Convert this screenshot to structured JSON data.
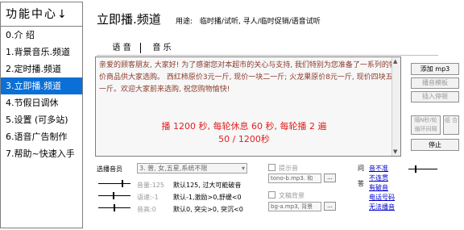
{
  "sidebar": {
    "title": "功能中心↓",
    "items": [
      {
        "label": "0.介 绍"
      },
      {
        "label": "1.背景音乐.频道"
      },
      {
        "label": "2.定时播.频道"
      },
      {
        "label": "3.立即播.频道"
      },
      {
        "label": "4.节假日调休"
      },
      {
        "label": "5.设置 (可多站)"
      },
      {
        "label": "6.语音广告制作"
      },
      {
        "label": "7.帮助~快速入手"
      }
    ],
    "active_index": 3
  },
  "header": {
    "title": "立即播.频道",
    "usage_label": "用途:",
    "usage_text": "临时播/试听, 寻人/临时促销/语音试听"
  },
  "tabs": [
    {
      "label": "语 音",
      "active": true
    },
    {
      "label": "音 乐",
      "active": false
    }
  ],
  "message": "亲爱的顾客朋友, 大家好! 为了感谢您对本超市的关心与支持, 我们特别为您准备了一系列的特价商品供大家选购。 西红柿原价3元一斤, 现价一块二一斤; 火龙果原价8元一斤, 现价四块五一斤。欢迎大家前来选购, 祝您购物愉快!",
  "playback": {
    "line1": "播 1200 秒, 每轮休息 60 秒, 每轮播 2 遍",
    "line2": "50 / 1200秒"
  },
  "buttons": {
    "add": "添加 mp3",
    "sample": "播音模板",
    "insert": "插入停顿",
    "interval": "隔N秒/轮 循环间隔",
    "combo": "组 合",
    "stop": "停止"
  },
  "voice": {
    "speaker_label": "选播音员",
    "speaker_value": "3. 普, 女,五星,系统不限",
    "volume_label": "音量:125",
    "volume_desc": "默认125, 过大可能破音",
    "rate_label": "语速:-1",
    "rate_desc": "默认-1,激励>0,舒缓<0",
    "pitch_label": "音高:0",
    "pitch_desc": "默认0, 突尖>0, 突沉<0"
  },
  "options": {
    "prompt_tone_label": "提示音",
    "prompt_tone_file": "tono-b.mp3. 和",
    "text_bg_label": "文稿背景",
    "text_bg_file": "bg-a.mp3, 背景",
    "dots": "..."
  },
  "faq": {
    "label_top": "问",
    "label_bottom": "答",
    "links": [
      "音不准",
      "不连贯",
      "有破音",
      "电话号码",
      "无法播音"
    ]
  }
}
